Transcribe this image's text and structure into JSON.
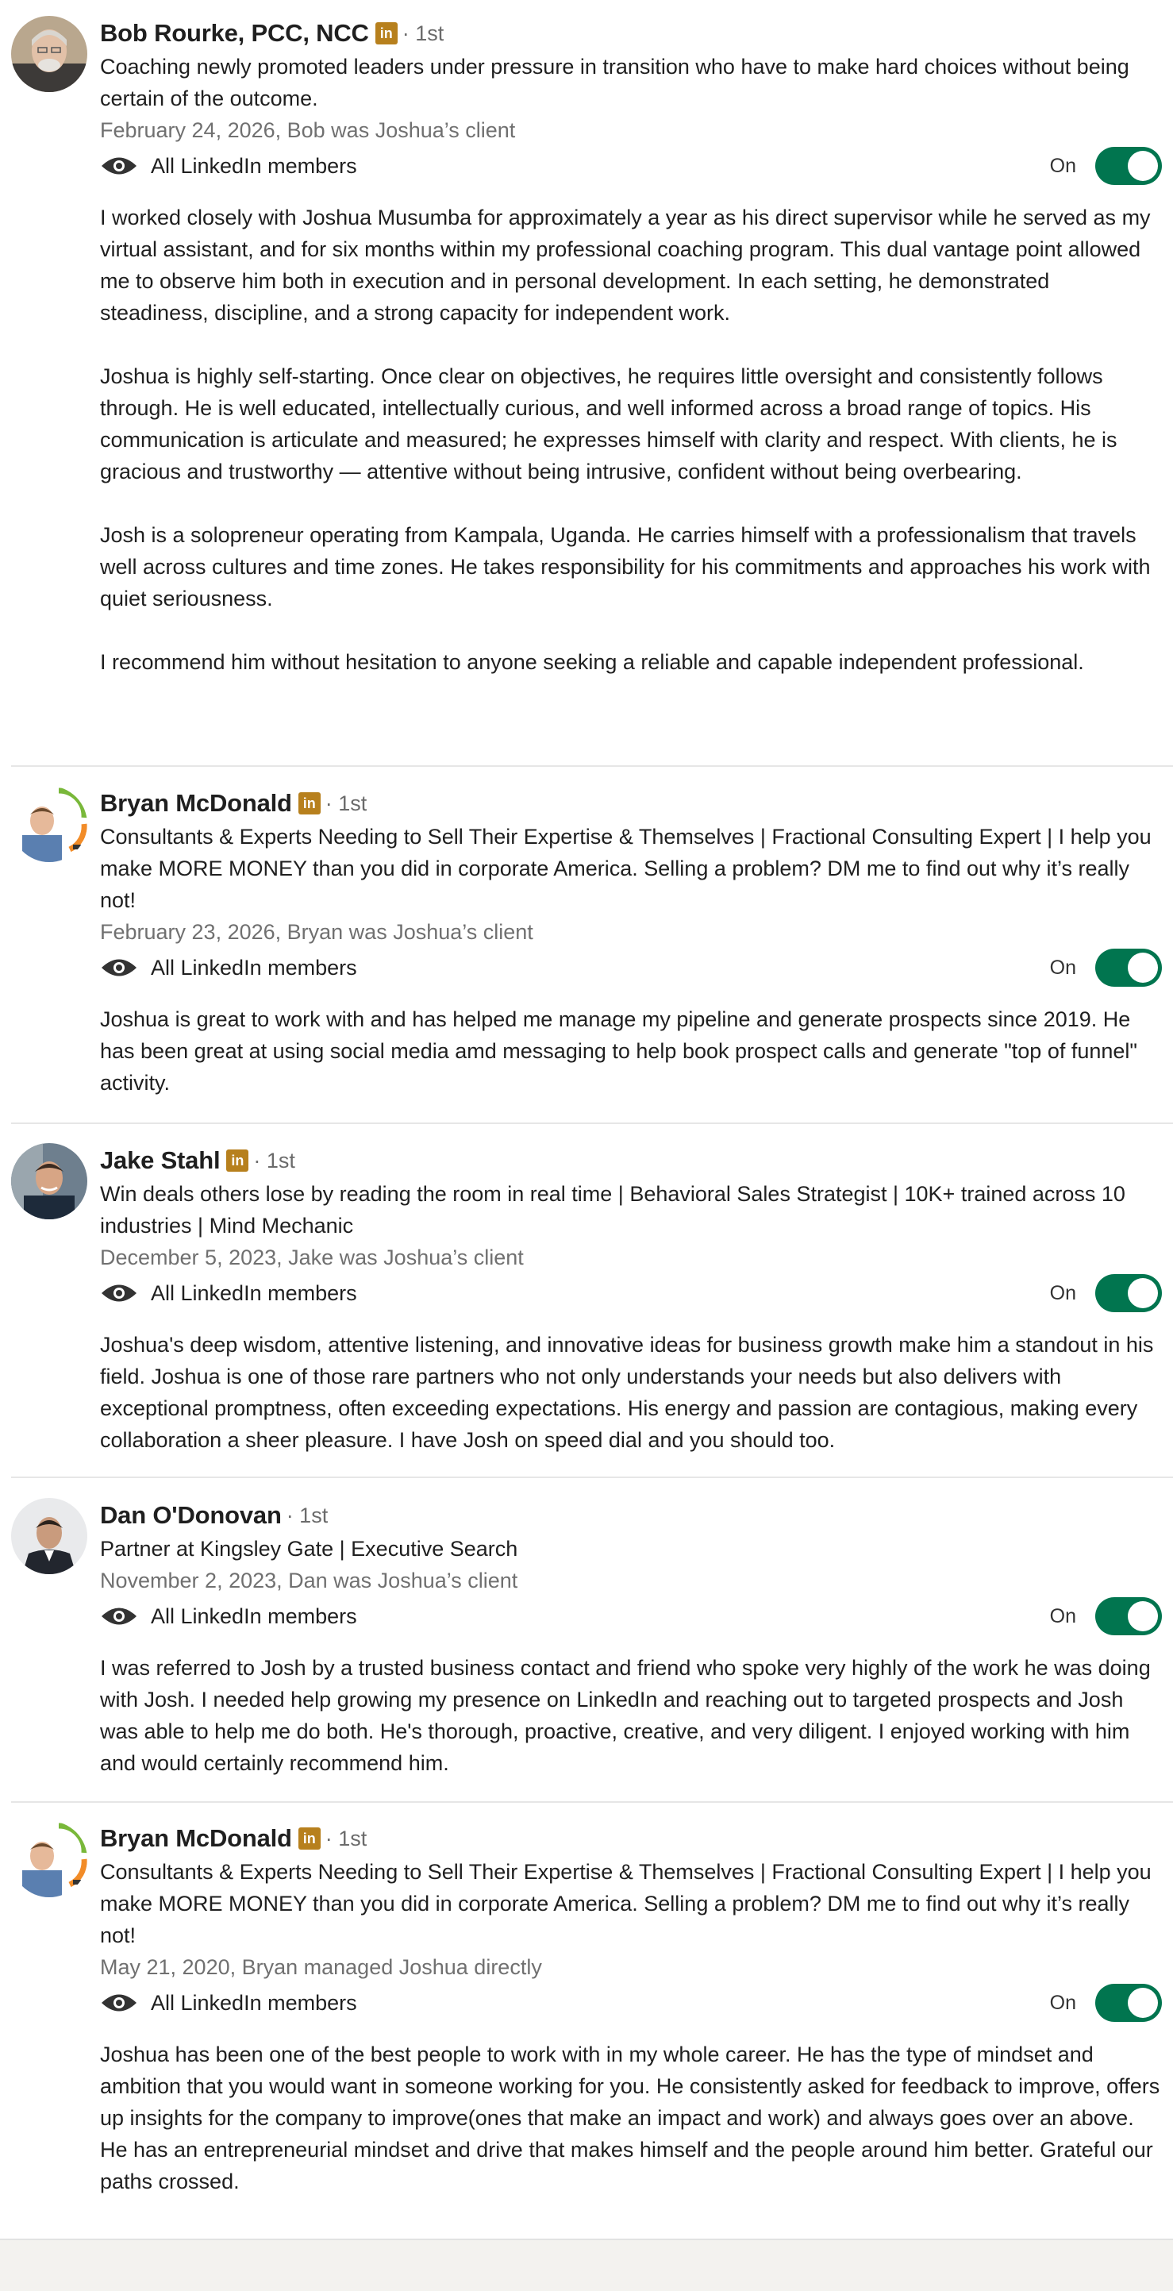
{
  "visibility_label": "All LinkedIn members",
  "toggle_label": "On",
  "badge_glyph": "in",
  "degree": "· 1st",
  "colors": {
    "toggle_on": "#01754f",
    "linkedin_badge": "#b7801d",
    "divider": "#e6e6e6"
  },
  "recommendations": [
    {
      "name": "Bob Rourke, PCC, NCC",
      "has_badge": true,
      "headline": "Coaching newly promoted leaders under pressure in transition who have to make hard choices without being certain of the outcome.",
      "date": "February 24, 2026, Bob was Joshua’s client",
      "toggle_on": true,
      "paragraphs": [
        "I worked closely with Joshua Musumba for approximately a year as his direct supervisor while he served as my virtual assistant, and for six months within my professional coaching program. This dual vantage point allowed me to observe him both in execution and in personal development. In each setting, he demonstrated steadiness, discipline, and a strong capacity for independent work.",
        "Joshua is highly self-starting. Once clear on objectives, he requires little oversight and consistently follows through. He is well educated, intellectually curious, and well informed across a broad range of topics. His communication is articulate and measured; he expresses himself with clarity and respect. With clients, he is gracious and trustworthy — attentive without being intrusive, confident without being overbearing.",
        "Josh is a solopreneur operating from Kampala, Uganda. He carries himself with a professionalism that travels well across cultures and time zones. He takes responsibility for his commitments and approaches his work with quiet seriousness.",
        "I recommend him without hesitation to anyone seeking a reliable and capable independent professional."
      ]
    },
    {
      "name": "Bryan McDonald",
      "has_badge": true,
      "headline": "Consultants & Experts Needing to Sell Their Expertise & Themselves | Fractional Consulting Expert | I help you make MORE MONEY than you did in corporate America. Selling a problem? DM me to find out why it’s really not!",
      "date": "February 23, 2026, Bryan was Joshua’s client",
      "toggle_on": true,
      "paragraphs": [
        "Joshua is great to work with and has helped me manage my pipeline and generate prospects since 2019. He has been great at using social media amd messaging to help book prospect calls and generate \"top of funnel\" activity."
      ]
    },
    {
      "name": "Jake Stahl",
      "has_badge": true,
      "headline": "Win deals others lose by reading the room in real time | Behavioral Sales Strategist | 10K+ trained across 10 industries | Mind Mechanic",
      "date": "December 5, 2023, Jake was Joshua’s client",
      "toggle_on": true,
      "paragraphs": [
        "Joshua's deep wisdom, attentive listening, and innovative ideas for business growth make him a standout in his field. Joshua is one of those rare partners who not only understands your needs but also delivers with exceptional promptness, often exceeding expectations. His energy and passion are contagious, making every collaboration a sheer pleasure. I have Josh on speed dial and you should too."
      ]
    },
    {
      "name": "Dan O'Donovan",
      "has_badge": false,
      "headline": "Partner at Kingsley Gate | Executive Search",
      "date": "November 2, 2023, Dan was Joshua’s client",
      "toggle_on": true,
      "paragraphs": [
        "I was referred to Josh by a trusted business contact and friend who spoke very highly of the work he was doing with Josh. I needed help growing my presence on LinkedIn and reaching out to targeted prospects and Josh was able to help me do both. He's thorough, proactive, creative, and very diligent. I enjoyed working with him and would certainly recommend him."
      ]
    },
    {
      "name": "Bryan McDonald",
      "has_badge": true,
      "headline": "Consultants & Experts Needing to Sell Their Expertise & Themselves | Fractional Consulting Expert | I help you make MORE MONEY than you did in corporate America. Selling a problem? DM me to find out why it’s really not!",
      "date": "May 21, 2020, Bryan managed Joshua directly",
      "toggle_on": true,
      "paragraphs": [
        "Joshua has been one of the best people to work with in my whole career. He has the type of mindset and ambition that you would want in someone working for you. He consistently asked for feedback to improve, offers up insights for the company to improve(ones that make an impact and work) and always goes over an above. He has an entrepreneurial mindset and drive that makes himself and the people around him better. Grateful our paths crossed."
      ]
    }
  ]
}
